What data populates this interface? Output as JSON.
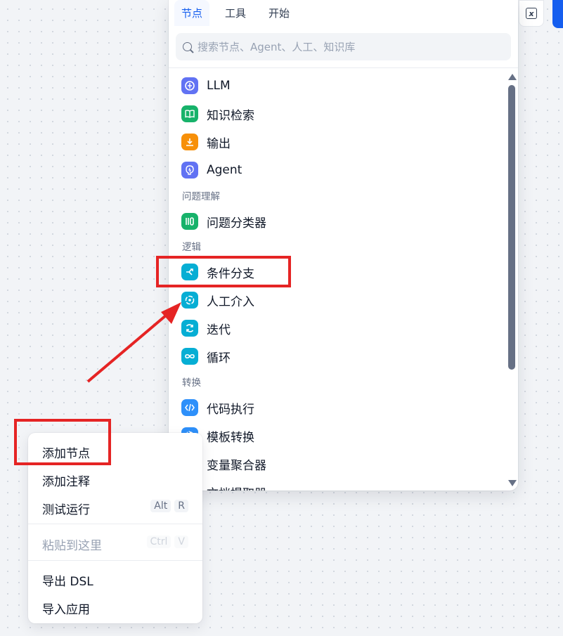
{
  "topbar": {
    "variable_icon": "variable-x-icon"
  },
  "panel": {
    "tabs": [
      {
        "label": "节点",
        "active": true
      },
      {
        "label": "工具",
        "active": false
      },
      {
        "label": "开始",
        "active": false
      }
    ],
    "search_placeholder": "搜索节点、Agent、人工、知识库",
    "items": [
      {
        "label": "LLM",
        "icon": "llm-icon",
        "color": "#6172f3"
      },
      {
        "label": "知识检索",
        "icon": "book-icon",
        "color": "#17b26a"
      },
      {
        "label": "输出",
        "icon": "output-icon",
        "color": "#f79009"
      },
      {
        "label": "Agent",
        "icon": "agent-icon",
        "color": "#6172f3"
      },
      {
        "label": "问题理解",
        "category": true
      },
      {
        "label": "问题分类器",
        "icon": "classifier-icon",
        "color": "#17b26a"
      },
      {
        "label": "逻辑",
        "category": true
      },
      {
        "label": "条件分支",
        "icon": "branch-icon",
        "color": "#06aed4"
      },
      {
        "label": "人工介入",
        "icon": "human-icon",
        "color": "#06aed4"
      },
      {
        "label": "迭代",
        "icon": "iteration-icon",
        "color": "#06aed4"
      },
      {
        "label": "循环",
        "icon": "loop-icon",
        "color": "#06aed4"
      },
      {
        "label": "转换",
        "category": true
      },
      {
        "label": "代码执行",
        "icon": "code-icon",
        "color": "#2e90fa"
      },
      {
        "label": "模板转换",
        "icon": "template-icon",
        "color": "#2e90fa"
      },
      {
        "label": "变量聚合器",
        "icon": "variable-aggregator-icon",
        "color": "#2e90fa"
      },
      {
        "label": "文档提取器",
        "icon": "doc-extractor-icon",
        "color": "#17b26a"
      }
    ]
  },
  "context_menu": {
    "items": [
      {
        "label": "添加节点"
      },
      {
        "label": "添加注释"
      },
      {
        "label": "测试运行",
        "shortcut": [
          "Alt",
          "R"
        ]
      },
      {
        "label": "粘贴到这里",
        "shortcut": [
          "Ctrl",
          "V"
        ],
        "disabled": true
      },
      {
        "label": "导出 DSL"
      },
      {
        "label": "导入应用"
      }
    ]
  },
  "annotation_color": "#e52424"
}
